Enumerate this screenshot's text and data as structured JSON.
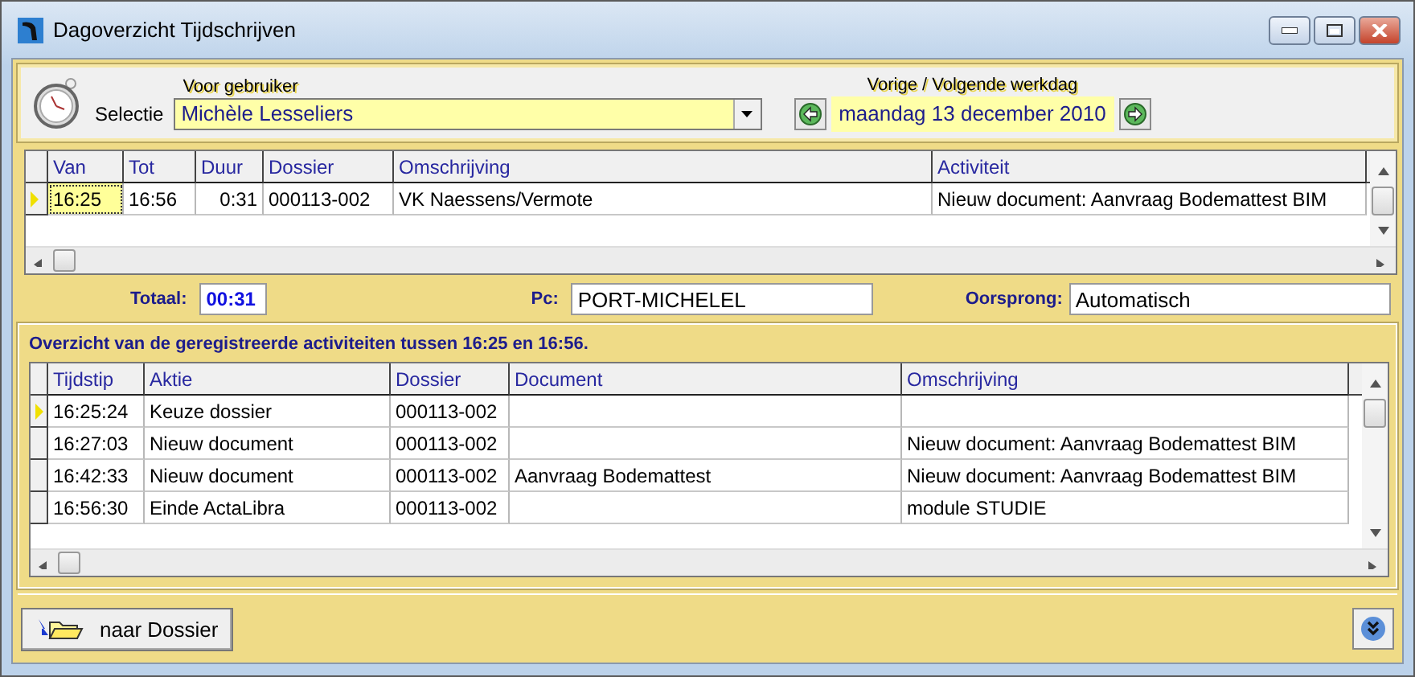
{
  "window": {
    "title": "Dagoverzicht Tijdschrijven"
  },
  "selection": {
    "label": "Selectie",
    "user_label": "Voor gebruiker",
    "user": "Michèle Lesseliers",
    "day_label": "Vorige / Volgende werkdag",
    "date": "maandag 13 december 2010"
  },
  "entries": {
    "columns": [
      "Van",
      "Tot",
      "Duur",
      "Dossier",
      "Omschrijving",
      "Activiteit"
    ],
    "rows": [
      {
        "selected": true,
        "cells": [
          "16:25",
          "16:56",
          "0:31",
          "000113-002",
          "VK Naessens/Vermote",
          "Nieuw document: Aanvraag Bodemattest BIM"
        ]
      }
    ]
  },
  "summary": {
    "total_label": "Totaal:",
    "total": "00:31",
    "pc_label": "Pc:",
    "pc": "PORT-MICHELEL",
    "origin_label": "Oorsprong:",
    "origin": "Automatisch"
  },
  "activities": {
    "caption": "Overzicht van de geregistreerde activiteiten tussen 16:25 en 16:56.",
    "columns": [
      "Tijdstip",
      "Aktie",
      "Dossier",
      "Document",
      "Omschrijving"
    ],
    "rows": [
      {
        "selected": true,
        "cells": [
          "16:25:24",
          "Keuze dossier",
          "000113-002",
          "",
          ""
        ]
      },
      {
        "selected": false,
        "cells": [
          "16:27:03",
          "Nieuw document",
          "000113-002",
          "",
          "Nieuw document: Aanvraag Bodemattest BIM"
        ]
      },
      {
        "selected": false,
        "cells": [
          "16:42:33",
          "Nieuw document",
          "000113-002",
          "Aanvraag Bodemattest",
          "Nieuw document: Aanvraag Bodemattest BIM"
        ]
      },
      {
        "selected": false,
        "cells": [
          "16:56:30",
          "Einde ActaLibra",
          "000113-002",
          "",
          "module STUDIE"
        ]
      }
    ]
  },
  "footer": {
    "button": "naar Dossier"
  }
}
